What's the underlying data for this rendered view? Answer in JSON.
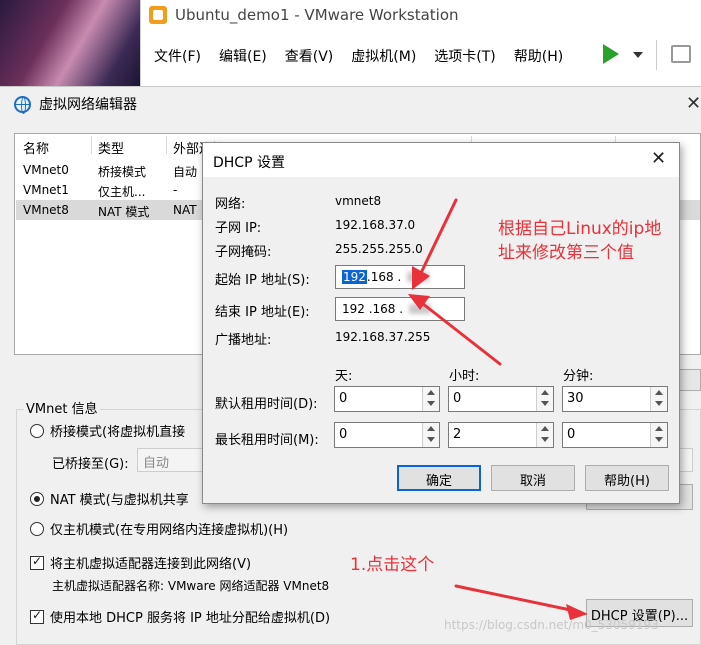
{
  "vmware": {
    "title": "Ubuntu_demo1 - VMware Workstation",
    "menu": [
      "文件(F)",
      "编辑(E)",
      "查看(V)",
      "虚拟机(M)",
      "选项卡(T)",
      "帮助(H)"
    ]
  },
  "editor": {
    "title": "虚拟网络编辑器",
    "columns": [
      "名称",
      "类型",
      "外部连接"
    ],
    "rows": [
      {
        "name": "VMnet0",
        "type": "桥接模式",
        "ext": "自动"
      },
      {
        "name": "VMnet1",
        "type": "仅主机...",
        "ext": "-"
      },
      {
        "name": "VMnet8",
        "type": "NAT 模式",
        "ext": "NAT"
      }
    ],
    "scroll_btn": "...",
    "info_legend": "VMnet 信息",
    "bridge_mode": "桥接模式(将虚拟机直接",
    "bridged_to_label": "已桥接至(G):",
    "bridged_to_value": "自动",
    "nat_mode": "NAT 模式(与虚拟机共享",
    "host_only_mode": "仅主机模式(在专用网络内连接虚拟机)(H)",
    "connect_adapter": "将主机虚拟适配器连接到此网络(V)",
    "adapter_name": "主机虚拟适配器名称: VMware 网络适配器 VMnet8",
    "use_dhcp": "使用本地 DHCP 服务将 IP 地址分配给虚拟机(D)",
    "dhcp_button": "DHCP 设置(P)..."
  },
  "dhcp": {
    "title": "DHCP 设置",
    "network_label": "网络:",
    "network_value": "vmnet8",
    "subnet_ip_label": "子网 IP:",
    "subnet_ip_value": "192.168.37.0",
    "subnet_mask_label": "子网掩码:",
    "subnet_mask_value": "255.255.255.0",
    "start_ip_label": "起始 IP 地址(S):",
    "start_ip_first": "192",
    "start_ip_rest": ".168 .",
    "end_ip_label": "结束 IP 地址(E):",
    "end_ip_value": "192 .168 .",
    "broadcast_label": "广播地址:",
    "broadcast_value": "192.168.37.255",
    "col_day": "天:",
    "col_hour": "小时:",
    "col_minute": "分钟:",
    "default_lease_label": "默认租用时间(D):",
    "default_lease": [
      "0",
      "0",
      "30"
    ],
    "max_lease_label": "最长租用时间(M):",
    "max_lease": [
      "0",
      "2",
      "0"
    ],
    "ok": "确定",
    "cancel": "取消",
    "help": "帮助(H)"
  },
  "annotations": {
    "note1_line1": "根据自己Linux的ip地",
    "note1_line2": "址来修改第三个值",
    "note2": "1.点击这个",
    "color": "#e8313a"
  },
  "watermark": "https://blog.csdn.net/m0_53059193"
}
